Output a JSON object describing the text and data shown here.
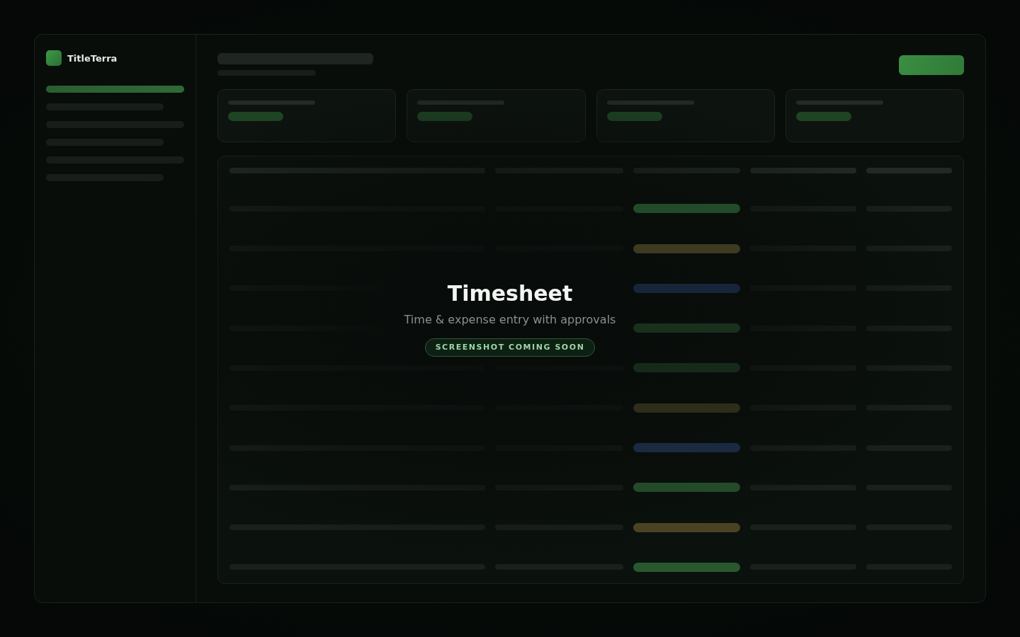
{
  "brand": {
    "name": "TitleTerra"
  },
  "sidebar": {
    "items": [
      {
        "selected": true
      },
      {
        "selected": false
      },
      {
        "selected": false
      },
      {
        "selected": false
      },
      {
        "selected": false
      },
      {
        "selected": false
      }
    ]
  },
  "table": {
    "rows": [
      {
        "color": "#234a29"
      },
      {
        "color": "#3d3a1f"
      },
      {
        "color": "#17253a"
      },
      {
        "color": "#19301d"
      },
      {
        "color": "#162a1a"
      },
      {
        "color": "#2e2c1a"
      },
      {
        "color": "#1a2a40"
      },
      {
        "color": "#234a29"
      },
      {
        "color": "#4a4222"
      },
      {
        "color": "#28592e"
      }
    ]
  },
  "placeholder": {
    "title": "Timesheet",
    "subtitle": "Time & expense entry with approvals",
    "badge": "SCREENSHOT COMING SOON"
  }
}
